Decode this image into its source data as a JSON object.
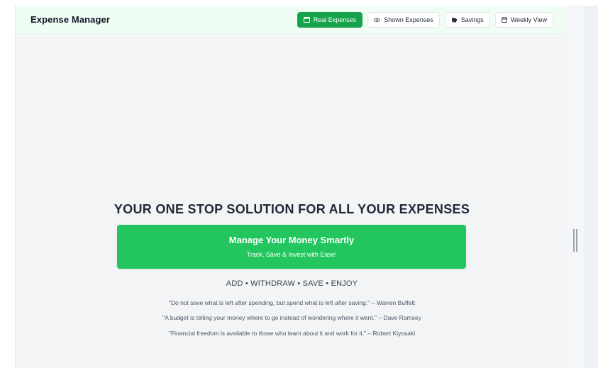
{
  "header": {
    "title": "Expense Manager",
    "nav": [
      {
        "label": "Real Expenses",
        "icon": "wallet-icon",
        "active": true
      },
      {
        "label": "Shown Expenses",
        "icon": "eye-icon",
        "active": false
      },
      {
        "label": "Savings",
        "icon": "piggy-bank-icon",
        "active": false
      },
      {
        "label": "Weekly View",
        "icon": "calendar-icon",
        "active": false
      }
    ]
  },
  "hero": {
    "title": "YOUR ONE STOP SOLUTION FOR ALL YOUR EXPENSES",
    "cta_main": "Manage Your Money Smartly",
    "cta_sub": "Track, Save & Invest with Ease!",
    "tagline": "ADD • WITHDRAW • SAVE • ENJOY",
    "quotes": [
      "\"Do not save what is left after spending, but spend what is left after saving.\" – Warren Buffett",
      "\"A budget is telling your money where to go instead of wondering where it went.\" – Dave Ramsey",
      "\"Financial freedom is available to those who learn about it and work for it.\" – Robert Kiyosaki"
    ]
  },
  "colors": {
    "accent": "#16a34a",
    "cta": "#22c55e",
    "header_bg": "#f0fdf4",
    "page_bg": "#f3f4f6"
  }
}
